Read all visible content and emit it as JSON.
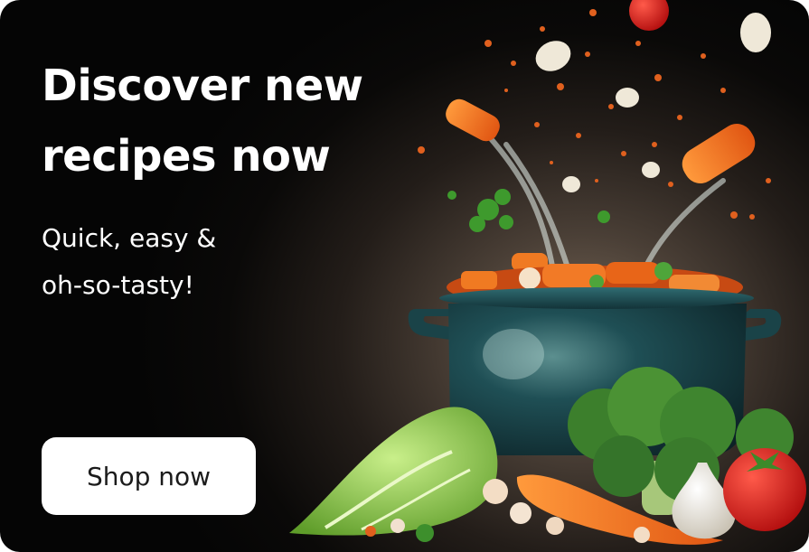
{
  "banner": {
    "headline_line1": "Discover new",
    "headline_line2": "recipes now",
    "subhead_line1": "Quick, easy &",
    "subhead_line2": "oh-so-tasty!",
    "cta_label": "Shop now"
  },
  "colors": {
    "background_dark": "#050505",
    "text": "#ffffff",
    "button_bg": "#ffffff",
    "button_text": "#1b1b1b",
    "pot": "#1f4f55",
    "carrot": "#f06a1f",
    "broccoli": "#3f8a2e",
    "tomato": "#d81e1e"
  },
  "illustration": {
    "subject": "cooking-pot-with-flying-vegetables",
    "icons": [
      "cooking-pot-icon",
      "carrot-icon",
      "broccoli-icon",
      "lettuce-icon",
      "tomato-icon",
      "garlic-icon"
    ]
  }
}
